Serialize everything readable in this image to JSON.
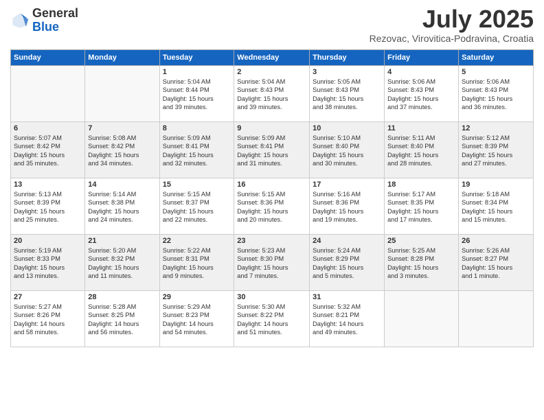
{
  "header": {
    "logo_general": "General",
    "logo_blue": "Blue",
    "month_title": "July 2025",
    "subtitle": "Rezovac, Virovitica-Podravina, Croatia"
  },
  "weekdays": [
    "Sunday",
    "Monday",
    "Tuesday",
    "Wednesday",
    "Thursday",
    "Friday",
    "Saturday"
  ],
  "weeks": [
    [
      {
        "day": "",
        "info": ""
      },
      {
        "day": "",
        "info": ""
      },
      {
        "day": "1",
        "info": "Sunrise: 5:04 AM\nSunset: 8:44 PM\nDaylight: 15 hours\nand 39 minutes."
      },
      {
        "day": "2",
        "info": "Sunrise: 5:04 AM\nSunset: 8:43 PM\nDaylight: 15 hours\nand 39 minutes."
      },
      {
        "day": "3",
        "info": "Sunrise: 5:05 AM\nSunset: 8:43 PM\nDaylight: 15 hours\nand 38 minutes."
      },
      {
        "day": "4",
        "info": "Sunrise: 5:06 AM\nSunset: 8:43 PM\nDaylight: 15 hours\nand 37 minutes."
      },
      {
        "day": "5",
        "info": "Sunrise: 5:06 AM\nSunset: 8:43 PM\nDaylight: 15 hours\nand 36 minutes."
      }
    ],
    [
      {
        "day": "6",
        "info": "Sunrise: 5:07 AM\nSunset: 8:42 PM\nDaylight: 15 hours\nand 35 minutes."
      },
      {
        "day": "7",
        "info": "Sunrise: 5:08 AM\nSunset: 8:42 PM\nDaylight: 15 hours\nand 34 minutes."
      },
      {
        "day": "8",
        "info": "Sunrise: 5:09 AM\nSunset: 8:41 PM\nDaylight: 15 hours\nand 32 minutes."
      },
      {
        "day": "9",
        "info": "Sunrise: 5:09 AM\nSunset: 8:41 PM\nDaylight: 15 hours\nand 31 minutes."
      },
      {
        "day": "10",
        "info": "Sunrise: 5:10 AM\nSunset: 8:40 PM\nDaylight: 15 hours\nand 30 minutes."
      },
      {
        "day": "11",
        "info": "Sunrise: 5:11 AM\nSunset: 8:40 PM\nDaylight: 15 hours\nand 28 minutes."
      },
      {
        "day": "12",
        "info": "Sunrise: 5:12 AM\nSunset: 8:39 PM\nDaylight: 15 hours\nand 27 minutes."
      }
    ],
    [
      {
        "day": "13",
        "info": "Sunrise: 5:13 AM\nSunset: 8:39 PM\nDaylight: 15 hours\nand 25 minutes."
      },
      {
        "day": "14",
        "info": "Sunrise: 5:14 AM\nSunset: 8:38 PM\nDaylight: 15 hours\nand 24 minutes."
      },
      {
        "day": "15",
        "info": "Sunrise: 5:15 AM\nSunset: 8:37 PM\nDaylight: 15 hours\nand 22 minutes."
      },
      {
        "day": "16",
        "info": "Sunrise: 5:15 AM\nSunset: 8:36 PM\nDaylight: 15 hours\nand 20 minutes."
      },
      {
        "day": "17",
        "info": "Sunrise: 5:16 AM\nSunset: 8:36 PM\nDaylight: 15 hours\nand 19 minutes."
      },
      {
        "day": "18",
        "info": "Sunrise: 5:17 AM\nSunset: 8:35 PM\nDaylight: 15 hours\nand 17 minutes."
      },
      {
        "day": "19",
        "info": "Sunrise: 5:18 AM\nSunset: 8:34 PM\nDaylight: 15 hours\nand 15 minutes."
      }
    ],
    [
      {
        "day": "20",
        "info": "Sunrise: 5:19 AM\nSunset: 8:33 PM\nDaylight: 15 hours\nand 13 minutes."
      },
      {
        "day": "21",
        "info": "Sunrise: 5:20 AM\nSunset: 8:32 PM\nDaylight: 15 hours\nand 11 minutes."
      },
      {
        "day": "22",
        "info": "Sunrise: 5:22 AM\nSunset: 8:31 PM\nDaylight: 15 hours\nand 9 minutes."
      },
      {
        "day": "23",
        "info": "Sunrise: 5:23 AM\nSunset: 8:30 PM\nDaylight: 15 hours\nand 7 minutes."
      },
      {
        "day": "24",
        "info": "Sunrise: 5:24 AM\nSunset: 8:29 PM\nDaylight: 15 hours\nand 5 minutes."
      },
      {
        "day": "25",
        "info": "Sunrise: 5:25 AM\nSunset: 8:28 PM\nDaylight: 15 hours\nand 3 minutes."
      },
      {
        "day": "26",
        "info": "Sunrise: 5:26 AM\nSunset: 8:27 PM\nDaylight: 15 hours\nand 1 minute."
      }
    ],
    [
      {
        "day": "27",
        "info": "Sunrise: 5:27 AM\nSunset: 8:26 PM\nDaylight: 14 hours\nand 58 minutes."
      },
      {
        "day": "28",
        "info": "Sunrise: 5:28 AM\nSunset: 8:25 PM\nDaylight: 14 hours\nand 56 minutes."
      },
      {
        "day": "29",
        "info": "Sunrise: 5:29 AM\nSunset: 8:23 PM\nDaylight: 14 hours\nand 54 minutes."
      },
      {
        "day": "30",
        "info": "Sunrise: 5:30 AM\nSunset: 8:22 PM\nDaylight: 14 hours\nand 51 minutes."
      },
      {
        "day": "31",
        "info": "Sunrise: 5:32 AM\nSunset: 8:21 PM\nDaylight: 14 hours\nand 49 minutes."
      },
      {
        "day": "",
        "info": ""
      },
      {
        "day": "",
        "info": ""
      }
    ]
  ]
}
